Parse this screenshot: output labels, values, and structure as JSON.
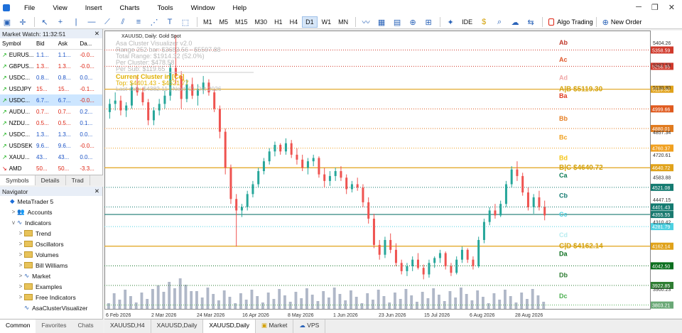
{
  "menu": [
    "File",
    "View",
    "Insert",
    "Charts",
    "Tools",
    "Window",
    "Help"
  ],
  "toolbar": {
    "timeframes": [
      "M1",
      "M5",
      "M15",
      "M30",
      "H1",
      "H4",
      "D1",
      "W1",
      "MN"
    ],
    "selected_timeframe": "D1",
    "ide": "IDE",
    "algo_trading": "Algo Trading",
    "new_order": "New Order"
  },
  "market_watch": {
    "title": "Market Watch: 11:32:51",
    "columns": [
      "Symbol",
      "Bid",
      "Ask",
      "Da..."
    ],
    "rows": [
      {
        "symbol": "EURUS...",
        "bid": "1.1...",
        "ask": "1.1...",
        "daily": "-0.0...",
        "dir": "up",
        "bid_color": "up"
      },
      {
        "symbol": "GBPUS...",
        "bid": "1.3...",
        "ask": "1.3...",
        "daily": "-0.0...",
        "dir": "up",
        "bid_color": "dn"
      },
      {
        "symbol": "USDC...",
        "bid": "0.8...",
        "ask": "0.8...",
        "daily": "0.0...",
        "dir": "up",
        "bid_color": "up"
      },
      {
        "symbol": "USDJPY",
        "bid": "15...",
        "ask": "15...",
        "daily": "-0.1...",
        "dir": "up",
        "bid_color": "dn"
      },
      {
        "symbol": "USDC...",
        "bid": "6.7...",
        "ask": "6.7...",
        "daily": "-0.0...",
        "dir": "up",
        "bid_color": "up",
        "selected": true
      },
      {
        "symbol": "AUDU...",
        "bid": "0.7...",
        "ask": "0.7...",
        "daily": "0.2...",
        "dir": "up",
        "bid_color": "dn"
      },
      {
        "symbol": "NZDU...",
        "bid": "0.5...",
        "ask": "0.5...",
        "daily": "0.1...",
        "dir": "up",
        "bid_color": "dn"
      },
      {
        "symbol": "USDC...",
        "bid": "1.3...",
        "ask": "1.3...",
        "daily": "0.0...",
        "dir": "up",
        "bid_color": "up"
      },
      {
        "symbol": "USDSEK",
        "bid": "9.6...",
        "ask": "9.6...",
        "daily": "-0.0...",
        "dir": "up",
        "bid_color": "up"
      },
      {
        "symbol": "XAUU...",
        "bid": "43...",
        "ask": "43...",
        "daily": "0.0...",
        "dir": "up",
        "bid_color": "up"
      },
      {
        "symbol": "AMD",
        "bid": "50...",
        "ask": "50...",
        "daily": "-3.3...",
        "dir": "dn",
        "bid_color": "dn"
      }
    ],
    "tabs": [
      "Symbols",
      "Details",
      "Trad"
    ]
  },
  "navigator": {
    "title": "Navigator",
    "items": [
      {
        "label": "MetaTrader 5",
        "level": 0,
        "caret": ""
      },
      {
        "label": "Accounts",
        "level": 1,
        "caret": ">"
      },
      {
        "label": "Indicators",
        "level": 1,
        "caret": "v"
      },
      {
        "label": "Trend",
        "level": 2,
        "caret": ">"
      },
      {
        "label": "Oscillators",
        "level": 2,
        "caret": ">"
      },
      {
        "label": "Volumes",
        "level": 2,
        "caret": ">"
      },
      {
        "label": "Bill Williams",
        "level": 2,
        "caret": ">"
      },
      {
        "label": "Market",
        "level": 2,
        "caret": ">"
      },
      {
        "label": "Examples",
        "level": 2,
        "caret": ">"
      },
      {
        "label": "Free Indicators",
        "level": 2,
        "caret": ">"
      },
      {
        "label": "AsaClusterVisualizer",
        "level": 2,
        "caret": ""
      }
    ]
  },
  "bottom_tabs": [
    "Common",
    "Favorites",
    "Chats"
  ],
  "chart_tabs": [
    "XAUUSD,H4",
    "XAUUSD,Daily",
    "XAUUSD,Daily",
    "Market",
    "VPS"
  ],
  "chart": {
    "symbol_line": "XAUUSD, Daily:  Gold Spot",
    "info_lines": [
      "Asa Cluster Visualizer v2.0",
      "Range 252 bar:  $3683.56 - $5597.88",
      "Total Range:  $1914.32 (52.0%)",
      "Per Cluster:  $478.58",
      "Per Sub:  $119.65"
    ],
    "current_cluster": "Current Cluster in [Cc]",
    "top_line": "Top: $4401.43 - $4521.77",
    "last_line": "Last calc: $4382.11 | Next: 01 Oct 2026",
    "cluster_labels": [
      {
        "text": "Ab",
        "color": "#c0392b",
        "price": 5404
      },
      {
        "text": "Ac",
        "color": "#e0572a",
        "price": 5300
      },
      {
        "text": "Ad",
        "color": "#f0a8a8",
        "price": 5190
      },
      {
        "text": "A|B  $5119.30",
        "color": "#d4a20a",
        "price": 5119.3,
        "bold": true
      },
      {
        "text": "Ba",
        "color": "#e03a1e",
        "price": 5078
      },
      {
        "text": "Bb",
        "color": "#e67e22",
        "price": 4940
      },
      {
        "text": "Bc",
        "color": "#f0a020",
        "price": 4825
      },
      {
        "text": "Bd",
        "color": "#f5c518",
        "price": 4700
      },
      {
        "text": "B|C  $4640.72",
        "color": "#d4a20a",
        "price": 4640.72,
        "bold": true
      },
      {
        "text": "Ca",
        "color": "#0b7a55",
        "price": 4595
      },
      {
        "text": "Cb",
        "color": "#137a70",
        "price": 4470
      },
      {
        "text": "Cc",
        "color": "#4dd0e1",
        "price": 4355
      },
      {
        "text": "Cd",
        "color": "#b8ecf0",
        "price": 4230
      },
      {
        "text": "C|D  $4162.14",
        "color": "#d4a20a",
        "price": 4162.14,
        "bold": true
      },
      {
        "text": "Da",
        "color": "#0a6e1e",
        "price": 4115
      },
      {
        "text": "Db",
        "color": "#2e7d32",
        "price": 3985
      },
      {
        "text": "Dc",
        "color": "#4caf50",
        "price": 3858
      }
    ],
    "levels": [
      {
        "price": 5358.59,
        "color": "#d0392b",
        "style": "dot",
        "tag": "5358.59",
        "tagbg": "#d0392b"
      },
      {
        "price": 5258.95,
        "color": "#d0392b",
        "style": "dot",
        "tag": "5258.95",
        "tagbg": "#d0392b"
      },
      {
        "price": 5119.3,
        "color": "#e0a21a",
        "style": "solid",
        "tag": "5119.30",
        "tagbg": "#e0a21a"
      },
      {
        "price": 4999.66,
        "color": "#e05a1e",
        "style": "dot",
        "tag": "4999.66",
        "tagbg": "#e05a1e"
      },
      {
        "price": 4880.01,
        "color": "#e07a1e",
        "style": "dot",
        "tag": "4880.01",
        "tagbg": "#e07a1e"
      },
      {
        "price": 4760.37,
        "color": "#f0a020",
        "style": "dot",
        "tag": "4760.37",
        "tagbg": "#f0a020"
      },
      {
        "price": 4640.72,
        "color": "#e0a21a",
        "style": "solid",
        "tag": "4640.72",
        "tagbg": "#e0a21a"
      },
      {
        "price": 4521.08,
        "color": "#137a70",
        "style": "dot",
        "tag": "4521.08",
        "tagbg": "#137a70"
      },
      {
        "price": 4401.43,
        "color": "#137a70",
        "style": "dot",
        "tag": "4401.43",
        "tagbg": "#137a70"
      },
      {
        "price": 4355.55,
        "color": "#1a7a70",
        "style": "solid",
        "tag": "4355.55",
        "tagbg": "#1a7a70"
      },
      {
        "price": 4281.79,
        "color": "#4dd0e1",
        "style": "dot",
        "tag": "4281.79",
        "tagbg": "#4dd0e1"
      },
      {
        "price": 4162.14,
        "color": "#e0a21a",
        "style": "solid",
        "tag": "4162.14",
        "tagbg": "#e0a21a"
      },
      {
        "price": 4042.5,
        "color": "#0a6e1e",
        "style": "dot",
        "tag": "4042.50",
        "tagbg": "#0a6e1e"
      },
      {
        "price": 3922.85,
        "color": "#2e7d32",
        "style": "dot",
        "tag": "3922.85",
        "tagbg": "#2e7d32"
      },
      {
        "price": 3803.21,
        "color": "#4caf50",
        "style": "dot",
        "tag": "3803.21",
        "tagbg": "#6aa876"
      }
    ],
    "price_ticks": [
      "5404.26",
      "5267.53",
      "5130.80",
      "4857.34",
      "4720.61",
      "4583.88",
      "4447.15",
      "4310.42",
      "3900.23"
    ],
    "date_ticks": [
      "6 Feb 2026",
      "2 Mar 2026",
      "24 Mar 2026",
      "16 Apr 2026",
      "8 May 2026",
      "1 Jun 2026",
      "23 Jun 2026",
      "15 Jul 2026",
      "6 Aug 2026",
      "28 Aug 2026"
    ]
  },
  "chart_data": {
    "type": "candlestick",
    "y_range": [
      3780,
      5460
    ],
    "candles": [
      [
        4980,
        5060,
        4940,
        5030
      ],
      [
        5030,
        5100,
        4990,
        5050
      ],
      [
        5050,
        5080,
        4960,
        4990
      ],
      [
        4990,
        5040,
        4950,
        5020
      ],
      [
        5020,
        5160,
        5000,
        5130
      ],
      [
        5130,
        5200,
        5080,
        5100
      ],
      [
        5100,
        5130,
        5020,
        5040
      ],
      [
        5040,
        5060,
        4900,
        4930
      ],
      [
        4930,
        5010,
        4900,
        4990
      ],
      [
        4990,
        5060,
        4960,
        5030
      ],
      [
        5030,
        5110,
        5000,
        5080
      ],
      [
        5080,
        5280,
        5050,
        5250
      ],
      [
        5250,
        5450,
        5150,
        5200
      ],
      [
        5200,
        5230,
        5000,
        5060
      ],
      [
        5060,
        5180,
        5040,
        5150
      ],
      [
        5150,
        5190,
        5060,
        5080
      ],
      [
        5080,
        5150,
        5020,
        5120
      ],
      [
        5120,
        5200,
        5090,
        5160
      ],
      [
        5160,
        5180,
        5080,
        5100
      ],
      [
        5100,
        5120,
        4980,
        5000
      ],
      [
        5000,
        5020,
        4820,
        4860
      ],
      [
        4860,
        4880,
        4600,
        4640
      ],
      [
        4640,
        4660,
        4420,
        4450
      ],
      [
        4450,
        4480,
        4160,
        4380
      ],
      [
        4380,
        4420,
        4340,
        4400
      ],
      [
        4400,
        4500,
        4380,
        4480
      ],
      [
        4480,
        4560,
        4460,
        4540
      ],
      [
        4540,
        4640,
        4520,
        4620
      ],
      [
        4620,
        4700,
        4600,
        4680
      ],
      [
        4680,
        4760,
        4660,
        4740
      ],
      [
        4740,
        4800,
        4710,
        4780
      ],
      [
        4780,
        4790,
        4720,
        4740
      ],
      [
        4740,
        4820,
        4720,
        4790
      ],
      [
        4790,
        4810,
        4700,
        4720
      ],
      [
        4720,
        4760,
        4660,
        4690
      ],
      [
        4690,
        4720,
        4620,
        4640
      ],
      [
        4640,
        4700,
        4600,
        4680
      ],
      [
        4680,
        4720,
        4650,
        4700
      ],
      [
        4700,
        4710,
        4580,
        4600
      ],
      [
        4600,
        4640,
        4520,
        4560
      ],
      [
        4560,
        4620,
        4530,
        4590
      ],
      [
        4590,
        4640,
        4560,
        4620
      ],
      [
        4620,
        4650,
        4560,
        4580
      ],
      [
        4580,
        4600,
        4480,
        4510
      ],
      [
        4510,
        4560,
        4490,
        4540
      ],
      [
        4540,
        4580,
        4500,
        4520
      ],
      [
        4520,
        4540,
        4400,
        4430
      ],
      [
        4430,
        4460,
        4300,
        4330
      ],
      [
        4330,
        4360,
        4150,
        4170
      ],
      [
        4170,
        4200,
        4080,
        4110
      ],
      [
        4110,
        4220,
        4090,
        4200
      ],
      [
        4200,
        4240,
        4120,
        4140
      ],
      [
        4140,
        4180,
        4040,
        4060
      ],
      [
        4060,
        4080,
        3990,
        4010
      ],
      [
        4010,
        4060,
        3980,
        4040
      ],
      [
        4040,
        4100,
        4010,
        4080
      ],
      [
        4080,
        4120,
        4020,
        4030
      ],
      [
        4030,
        4050,
        3960,
        3990
      ],
      [
        3990,
        4080,
        3970,
        4060
      ],
      [
        4060,
        4100,
        4030,
        4090
      ],
      [
        4090,
        4140,
        4060,
        4120
      ],
      [
        4120,
        4130,
        4020,
        4040
      ],
      [
        4040,
        4060,
        3980,
        4000
      ],
      [
        4000,
        4100,
        3990,
        4080
      ],
      [
        4080,
        4160,
        4060,
        4140
      ],
      [
        4140,
        4150,
        4060,
        4080
      ],
      [
        4080,
        4100,
        4020,
        4040
      ],
      [
        4040,
        4220,
        4030,
        4200
      ],
      [
        4200,
        4330,
        4180,
        4310
      ],
      [
        4310,
        4400,
        4290,
        4380
      ],
      [
        4380,
        4420,
        4330,
        4350
      ],
      [
        4350,
        4440,
        4340,
        4420
      ],
      [
        4420,
        4560,
        4400,
        4540
      ],
      [
        4540,
        4650,
        4520,
        4630
      ],
      [
        4630,
        4680,
        4560,
        4590
      ],
      [
        4590,
        4610,
        4470,
        4490
      ],
      [
        4490,
        4520,
        4380,
        4400
      ],
      [
        4400,
        4480,
        4360,
        4460
      ],
      [
        4460,
        4500,
        4380,
        4400
      ],
      [
        4400,
        4440,
        4320,
        4350
      ]
    ]
  }
}
